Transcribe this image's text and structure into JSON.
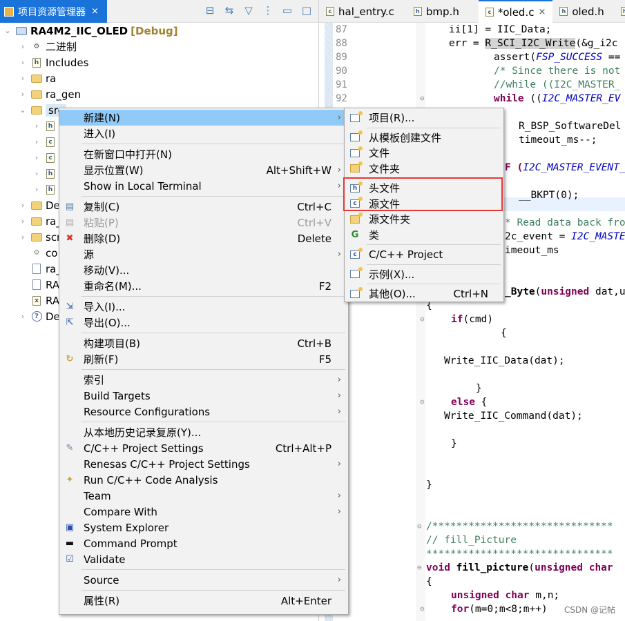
{
  "explorer": {
    "tab_label": "项目资源管理器",
    "tab_close": "×",
    "toolbar_icons": [
      "collapse-all-icon",
      "link-editor-icon",
      "filter-icon",
      "view-menu-icon",
      "minimize-icon",
      "maximize-icon"
    ],
    "toolbar_glyphs": [
      "⊟",
      "⇆",
      "▽",
      "⋮",
      "▭",
      "□"
    ],
    "project": {
      "name": "RA4M2_IIC_OLED",
      "config": "[Debug]"
    },
    "items": [
      {
        "label": "二进制",
        "icon": "binaries-icon"
      },
      {
        "label": "Includes",
        "icon": "includes-icon"
      },
      {
        "label": "ra",
        "icon": "source-folder-icon"
      },
      {
        "label": "ra_gen",
        "icon": "source-folder-icon"
      },
      {
        "label": "src",
        "icon": "source-folder-icon"
      },
      {
        "label": "",
        "icon": "header-file-icon"
      },
      {
        "label": "",
        "icon": "c-file-icon"
      },
      {
        "label": "",
        "icon": "c-file-icon"
      },
      {
        "label": "",
        "icon": "header-file-icon"
      },
      {
        "label": "",
        "icon": "header-file-icon"
      },
      {
        "label": "De",
        "icon": "folder-icon"
      },
      {
        "label": "ra_",
        "icon": "folder-icon"
      },
      {
        "label": "scr",
        "icon": "folder-icon"
      },
      {
        "label": "co",
        "icon": "gear-icon"
      },
      {
        "label": "ra_",
        "icon": "text-file-icon"
      },
      {
        "label": "RA",
        "icon": "text-file-icon"
      },
      {
        "label": "RA",
        "icon": "xml-file-icon"
      },
      {
        "label": "De",
        "icon": "help-icon"
      }
    ]
  },
  "editor": {
    "tabs": [
      {
        "label": "hal_entry.c",
        "type": "c"
      },
      {
        "label": "bmp.h",
        "type": "h"
      },
      {
        "label": "*oled.c",
        "type": "c",
        "active": true,
        "close": "×"
      },
      {
        "label": "oled.h",
        "type": "h"
      },
      {
        "label": "",
        "type": "h"
      }
    ],
    "line_numbers": [
      "87",
      "88",
      "89",
      "90",
      "91",
      "92"
    ],
    "code": {
      "l87": "ii[1] = IIC_Data;",
      "l88a": "err = ",
      "l88b": "R_SCI_I2C_Write",
      "l88c": "(&g_i2c",
      "l89a": "assert(",
      "l89b": "FSP_SUCCESS",
      "l89c": " ==",
      "l90": "/* Since there is not",
      "l91": "//while ((I2C_MASTER_",
      "l92a": "while",
      "l92b": " ((",
      "l92c": "I2C_MASTER_EV",
      "l94": "R_BSP_SoftwareDel",
      "l95": "timeout_ms--;",
      "l97a": "F (",
      "l97b": "I2C_MASTER_EVENT_",
      "l99": "__BKPT(0);",
      "l101": "* Read data back fro",
      "l102a": "2c_event = ",
      "l102b": "I2C_MASTE",
      "l103": "imeout_ms",
      "l106a": "_Byte",
      "l106b": "(",
      "l106c": "unsigned",
      "l106d": " dat,u",
      "l107": "{",
      "l108a": "if",
      "l108b": "(cmd)",
      "l109": "{",
      "l111": "Write_IIC_Data(dat);",
      "l113": "}",
      "l114a": "else",
      "l114b": " {",
      "l115": "Write_IIC_Command(dat);",
      "l117": "}",
      "l120": "}",
      "l123": "/******************************",
      "l124": "// fill_Picture",
      "l125": "*******************************",
      "l126a": "void",
      "l126b": " fill_picture",
      "l126c": "(",
      "l126d": "unsigned char",
      "l127": "{",
      "l128a": "unsigned char",
      "l128b": " m,n;",
      "l129a": "for",
      "l129b": "(m=0;m<8;m++)"
    }
  },
  "context_menu": {
    "items": [
      {
        "label": "新建(N)",
        "submenu": true,
        "selected": true
      },
      {
        "label": "进入(I)"
      },
      {
        "separator": true
      },
      {
        "label": "在新窗口中打开(N)"
      },
      {
        "label": "显示位置(W)",
        "shortcut": "Alt+Shift+W",
        "submenu": true
      },
      {
        "label": "Show in Local Terminal",
        "submenu": true
      },
      {
        "separator": true
      },
      {
        "label": "复制(C)",
        "shortcut": "Ctrl+C",
        "icon": "copy-icon"
      },
      {
        "label": "粘贴(P)",
        "shortcut": "Ctrl+V",
        "icon": "paste-icon",
        "disabled": true
      },
      {
        "label": "删除(D)",
        "shortcut": "Delete",
        "icon": "delete-icon"
      },
      {
        "label": "源",
        "submenu": true
      },
      {
        "label": "移动(V)..."
      },
      {
        "label": "重命名(M)...",
        "shortcut": "F2"
      },
      {
        "separator": true
      },
      {
        "label": "导入(I)...",
        "icon": "import-icon"
      },
      {
        "label": "导出(O)...",
        "icon": "export-icon"
      },
      {
        "separator": true
      },
      {
        "label": "构建项目(B)",
        "shortcut": "Ctrl+B"
      },
      {
        "label": "刷新(F)",
        "shortcut": "F5",
        "icon": "refresh-icon"
      },
      {
        "separator": true
      },
      {
        "label": "索引",
        "submenu": true
      },
      {
        "label": "Build Targets",
        "submenu": true
      },
      {
        "label": "Resource Configurations",
        "submenu": true
      },
      {
        "separator": true
      },
      {
        "label": "从本地历史记录复原(Y)..."
      },
      {
        "label": "C/C++ Project Settings",
        "shortcut": "Ctrl+Alt+P",
        "icon": "project-settings-icon"
      },
      {
        "label": "Renesas C/C++ Project Settings",
        "submenu": true
      },
      {
        "label": "Run C/C++ Code Analysis",
        "icon": "code-analysis-icon"
      },
      {
        "label": "Team",
        "submenu": true
      },
      {
        "label": "Compare With",
        "submenu": true
      },
      {
        "label": "System Explorer",
        "icon": "system-explorer-icon"
      },
      {
        "label": "Command Prompt",
        "icon": "command-prompt-icon"
      },
      {
        "label": "Validate",
        "icon": "checkbox-icon"
      },
      {
        "separator": true
      },
      {
        "label": "Source",
        "submenu": true
      },
      {
        "separator": true
      },
      {
        "label": "属性(R)",
        "shortcut": "Alt+Enter"
      }
    ]
  },
  "submenu_new": {
    "items": [
      {
        "label": "项目(R)...",
        "icon": "new-project-icon"
      },
      {
        "separator": true
      },
      {
        "label": "从模板创建文件",
        "icon": "new-file-icon"
      },
      {
        "label": "文件",
        "icon": "new-file-icon"
      },
      {
        "label": "文件夹",
        "icon": "new-folder-icon"
      },
      {
        "separator": true
      },
      {
        "label": "头文件",
        "icon": "new-header-file-icon",
        "highlighted": true
      },
      {
        "label": "源文件",
        "icon": "new-source-file-icon",
        "highlighted": true
      },
      {
        "label": "源文件夹",
        "icon": "new-source-folder-icon"
      },
      {
        "label": "类",
        "icon": "new-class-icon"
      },
      {
        "separator": true
      },
      {
        "label": "C/C++ Project",
        "icon": "new-cpp-project-icon"
      },
      {
        "separator": true
      },
      {
        "label": "示例(X)...",
        "icon": "examples-icon"
      },
      {
        "separator": true
      },
      {
        "label": "其他(O)...",
        "shortcut": "Ctrl+N",
        "icon": "other-wizard-icon"
      }
    ]
  },
  "annotation": {
    "highlight_color": "#e53935"
  },
  "watermark": "CSDN @记帖"
}
